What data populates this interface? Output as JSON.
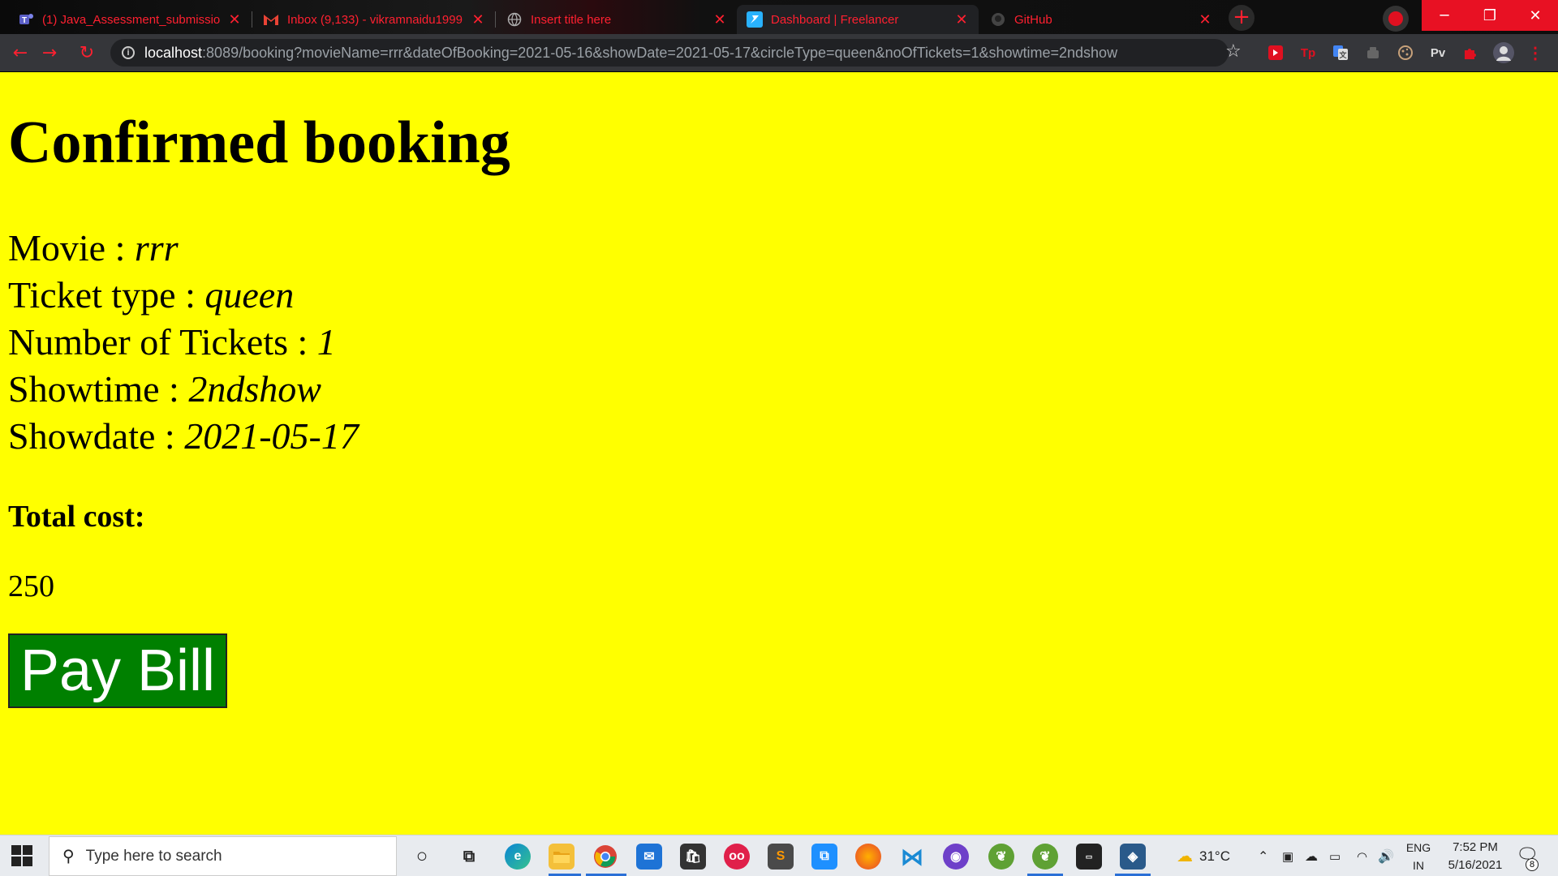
{
  "browser": {
    "tabs": [
      {
        "title": "(1) Java_Assessment_submission",
        "icon": "teams-icon"
      },
      {
        "title": "Inbox (9,133) - vikramnaidu1999",
        "icon": "gmail-icon"
      },
      {
        "title": "Insert title here",
        "icon": "globe-icon"
      },
      {
        "title": "Dashboard | Freelancer",
        "icon": "freelancer-icon"
      },
      {
        "title": "GitHub",
        "icon": "github-icon"
      }
    ],
    "url_host": "localhost",
    "url_rest": ":8089/booking?movieName=rrr&dateOfBooking=2021-05-16&showDate=2021-05-17&circleType=queen&noOfTickets=1&showtime=2ndshow",
    "extension_pv": "Pv",
    "extension_tp": "Tp"
  },
  "page": {
    "title": "Confirmed booking",
    "details": [
      {
        "label": "Movie : ",
        "value": "rrr"
      },
      {
        "label": "Ticket type : ",
        "value": "queen"
      },
      {
        "label": "Number of Tickets : ",
        "value": "1"
      },
      {
        "label": "Showtime : ",
        "value": "2ndshow"
      },
      {
        "label": "Showdate : ",
        "value": "2021-05-17"
      }
    ],
    "total_cost_label": "Total cost:",
    "total_cost_value": "250",
    "pay_button": "Pay Bill",
    "background_color": "#ffff00",
    "button_color": "#008000"
  },
  "taskbar": {
    "search_placeholder": "Type here to search",
    "weather": "31°C",
    "lang_top": "ENG",
    "lang_bottom": "IN",
    "time": "7:52 PM",
    "date": "5/16/2021",
    "notification_count": "8"
  }
}
